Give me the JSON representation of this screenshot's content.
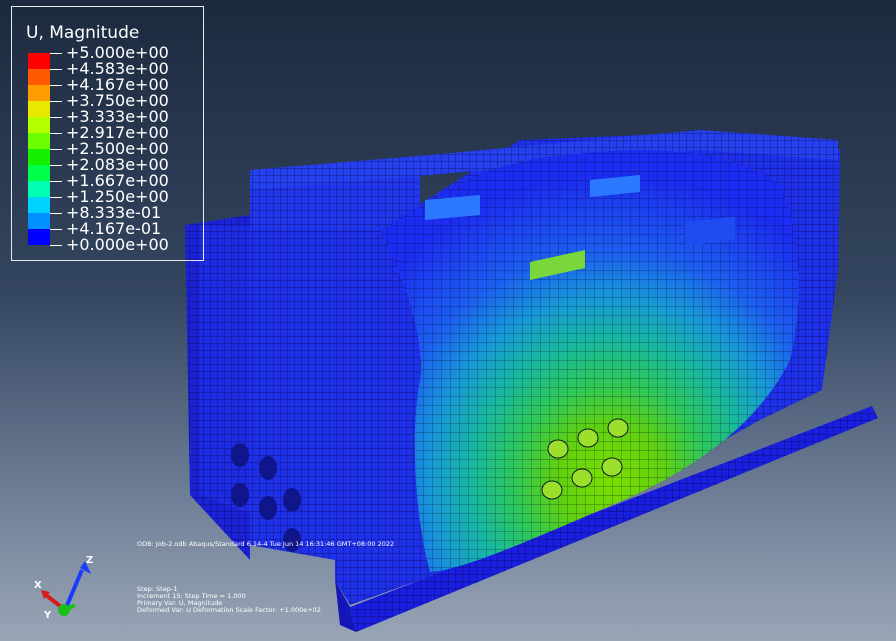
{
  "legend": {
    "title": "U, Magnitude",
    "levels": [
      {
        "label": "+5.000e+00",
        "color": "#ff0000"
      },
      {
        "label": "+4.583e+00",
        "color": "#ff5a00"
      },
      {
        "label": "+4.167e+00",
        "color": "#ff9d00"
      },
      {
        "label": "+3.750e+00",
        "color": "#e8e800"
      },
      {
        "label": "+3.333e+00",
        "color": "#b4ff00"
      },
      {
        "label": "+2.917e+00",
        "color": "#6cff00"
      },
      {
        "label": "+2.500e+00",
        "color": "#14f000"
      },
      {
        "label": "+2.083e+00",
        "color": "#00ff4a"
      },
      {
        "label": "+1.667e+00",
        "color": "#00ffb0"
      },
      {
        "label": "+1.250e+00",
        "color": "#00d2ff"
      },
      {
        "label": "+8.333e-01",
        "color": "#0090ff"
      },
      {
        "label": "+4.167e-01",
        "color": "#004aff"
      },
      {
        "label": "+0.000e+00",
        "color": "#0000ff"
      }
    ]
  },
  "info": {
    "odb_line": "ODB: Job-2.odb    Abaqus/Standard 6.14-4    Tue Jun 14 16:31:46 GMT+08:00 2022",
    "step_line": "Step: Step-1",
    "increment_line": "Increment      15: Step Time =    1.000",
    "primary_var_line": "Primary Var: U, Magnitude",
    "deformed_var_line": "Deformed Var: U   Deformation Scale Factor: +1.000e+02"
  },
  "triad": {
    "x_label": "X",
    "y_label": "Y",
    "z_label": "Z",
    "x_color": "#d81c1c",
    "y_color": "#18c018",
    "z_color": "#1a3cff"
  }
}
